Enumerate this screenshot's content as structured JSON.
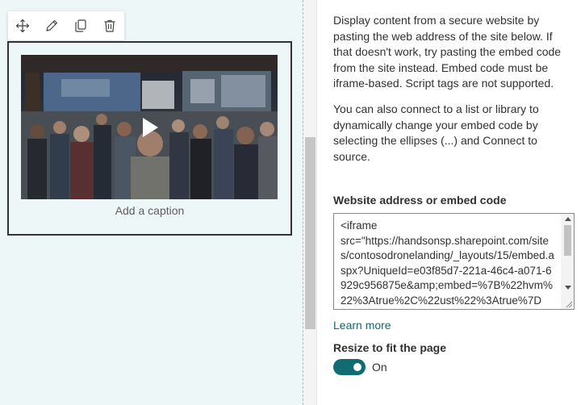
{
  "toolbar": {
    "icons": [
      "move-icon",
      "edit-icon",
      "duplicate-icon",
      "delete-icon"
    ]
  },
  "webpart": {
    "caption_placeholder": "Add a caption"
  },
  "panel": {
    "description_1": "Display content from a secure website by pasting the web address of the site below. If that doesn't work, try pasting the embed code from the site instead. Embed code must be iframe-based. Script tags are not supported.",
    "description_2": "You can also connect to a list or library to dynamically change your embed code by selecting the ellipses (...) and Connect to source.",
    "field_label": "Website address or embed code",
    "embed_code": "<iframe\nsrc=\"https://handsonsp.sharepoint.com/sites/contosodronelanding/_layouts/15/embed.aspx?UniqueId=e03f85d7-221a-46c4-a071-6929c956875e&amp;embed=%7B%22hvm%22%3Atrue%2C%22ust%22%3Atrue%7D",
    "learn_more": "Learn more",
    "resize_label": "Resize to fit the page",
    "toggle_state": "On"
  },
  "colors": {
    "accent": "#106b73",
    "canvas_bg": "#eef7f8"
  }
}
